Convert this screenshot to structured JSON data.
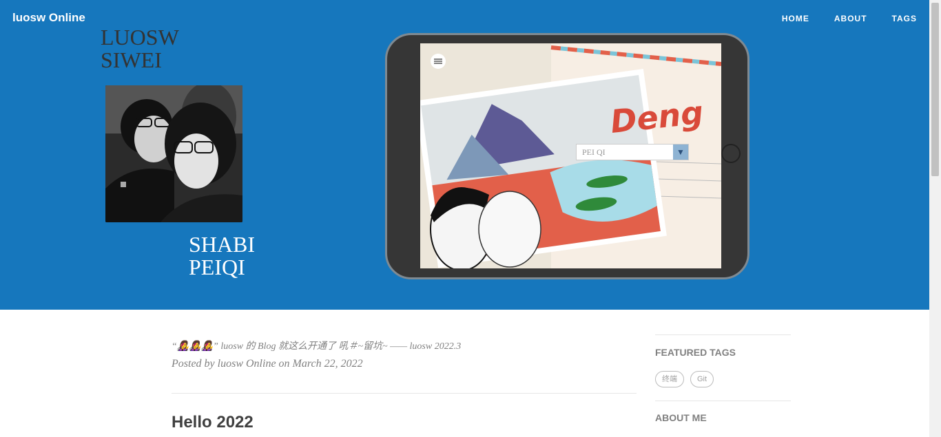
{
  "navbar": {
    "brand": "luosw Online",
    "links": [
      "HOME",
      "ABOUT",
      "TAGS"
    ]
  },
  "hero": {
    "name_top_line1": "LUOSW",
    "name_top_line2": "SIWEI",
    "name_bottom_line1": "SHABI",
    "name_bottom_line2": "PEIQI",
    "postcard_word": "Deng",
    "dropdown_value": "PEI QI",
    "colors": {
      "background": "#1677bd",
      "tablet": "#363636",
      "postcard_red": "#e2604a"
    }
  },
  "post": {
    "subtitle": "“👩‍🎤👩‍🎤👩‍🎤” luosw 的 Blog 就这么开通了 吼＃~留坑~ —— luosw 2022.3",
    "posted_by": "Posted by luosw Online on March 22, 2022",
    "title": "Hello 2022"
  },
  "sidebar": {
    "featured_tags_heading": "FEATURED TAGS",
    "tags": [
      "终端",
      "Git"
    ],
    "about_heading": "ABOUT ME"
  }
}
